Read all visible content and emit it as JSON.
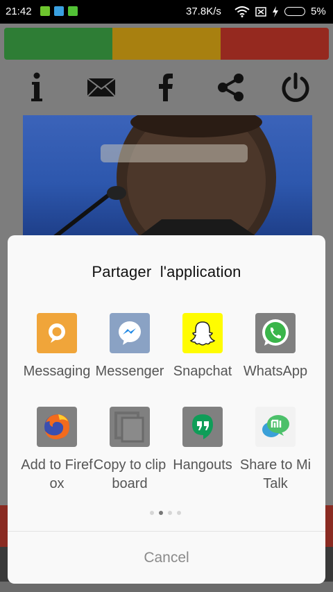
{
  "status_bar": {
    "time": "21:42",
    "speed": "37.8K/s",
    "battery": "5%"
  },
  "app": {
    "color_bar": [
      "#2e9a3f",
      "#dba515",
      "#cc3a2d"
    ],
    "toolbar": [
      "info-icon",
      "mail-icon",
      "facebook-icon",
      "share-icon",
      "power-icon"
    ]
  },
  "share_sheet": {
    "title": "Partager  l'application",
    "items": [
      {
        "label": "Messaging",
        "icon": "messaging-icon",
        "color": "#f0a53a"
      },
      {
        "label": "Messenger",
        "icon": "messenger-icon",
        "color": "#8aa2c4"
      },
      {
        "label": "Snapchat",
        "icon": "snapchat-icon",
        "color": "#fffc00"
      },
      {
        "label": "WhatsApp",
        "icon": "whatsapp-icon",
        "color": "#808080"
      },
      {
        "label": "Add to Firefox",
        "icon": "firefox-icon",
        "color": "#808080"
      },
      {
        "label": "Copy to clipboard",
        "icon": "clipboard-icon",
        "color": "#808080"
      },
      {
        "label": "Hangouts",
        "icon": "hangouts-icon",
        "color": "#808080"
      },
      {
        "label": "Share to Mi Talk",
        "icon": "mi-talk-icon",
        "color": "#f2f2f2"
      }
    ],
    "cancel_label": "Cancel"
  }
}
